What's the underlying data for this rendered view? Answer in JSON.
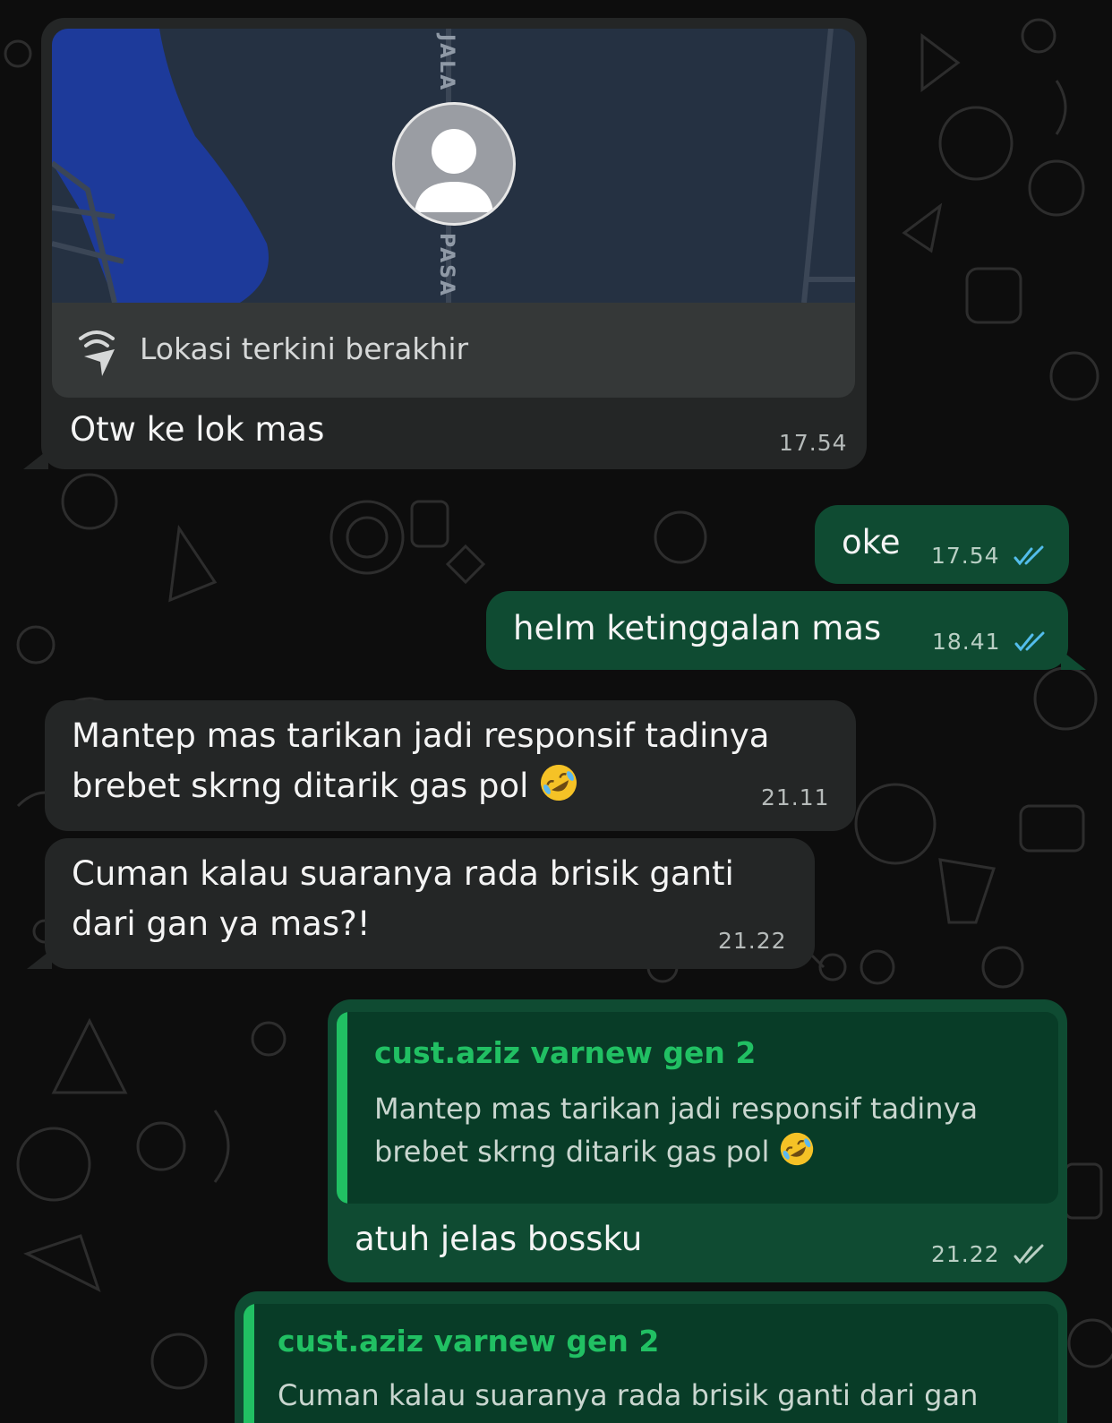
{
  "theme": {
    "incoming_bubble": "#242626",
    "outgoing_bubble": "#0f4b32",
    "quote_accent": "#21c063",
    "read_tick": "#53bdeb"
  },
  "messages": {
    "location": {
      "map_road_label_top": "JALA",
      "map_road_label_bottom": "PASA",
      "status_icon": "live-location-icon",
      "status_text": "Lokasi terkini berakhir",
      "text": "Otw ke lok mas",
      "time": "17.54"
    },
    "oke": {
      "text": "oke",
      "time": "17.54",
      "status": "read"
    },
    "helm": {
      "text": "helm ketinggalan mas",
      "time": "18.41",
      "status": "read"
    },
    "mantep": {
      "line1": "Mantep mas tarikan jadi responsif tadinya",
      "line2": "brebet skrng ditarik gas pol",
      "emoji": "rolling-on-floor-laughing",
      "time": "21.11"
    },
    "cuman": {
      "line1": "Cuman kalau suaranya rada brisik ganti",
      "line2": "dari gan ya mas?!",
      "time": "21.22"
    },
    "reply1": {
      "quote_author": "cust.aziz varnew gen 2",
      "quote_line1": "Mantep mas tarikan jadi responsif tadinya",
      "quote_line2": "brebet skrng ditarik gas pol",
      "text": "atuh jelas bossku",
      "time": "21.22",
      "status": "delivered"
    },
    "reply2": {
      "quote_author": "cust.aziz varnew gen 2",
      "quote_line1": "Cuman kalau suaranya rada brisik ganti dari gan"
    }
  }
}
